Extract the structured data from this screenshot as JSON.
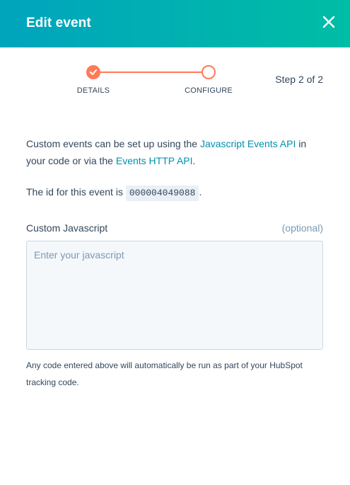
{
  "header": {
    "title": "Edit event",
    "close_icon": "close-icon",
    "gradient_start": "#00a4bd",
    "gradient_end": "#00bda5"
  },
  "stepper": {
    "steps": [
      {
        "label": "DETAILS",
        "status": "complete",
        "icon": "checkmark-icon"
      },
      {
        "label": "CONFIGURE",
        "status": "current"
      }
    ],
    "step_count": "Step 2 of 2",
    "accent_color": "#ff7a59"
  },
  "description": {
    "part1": "Custom events can be set up using the ",
    "link1": "Javascript Events API",
    "part2": " in your code or via the ",
    "link2": "Events HTTP API",
    "part3": ".",
    "link_color": "#0091ae"
  },
  "event_id": {
    "prefix": "The id for this event is ",
    "value": "000004049088",
    "suffix": "."
  },
  "custom_js": {
    "label": "Custom Javascript",
    "optional": "(optional)",
    "placeholder": "Enter your javascript",
    "value": ""
  },
  "help_text": "Any code entered above will automatically be run as part of your HubSpot tracking code."
}
